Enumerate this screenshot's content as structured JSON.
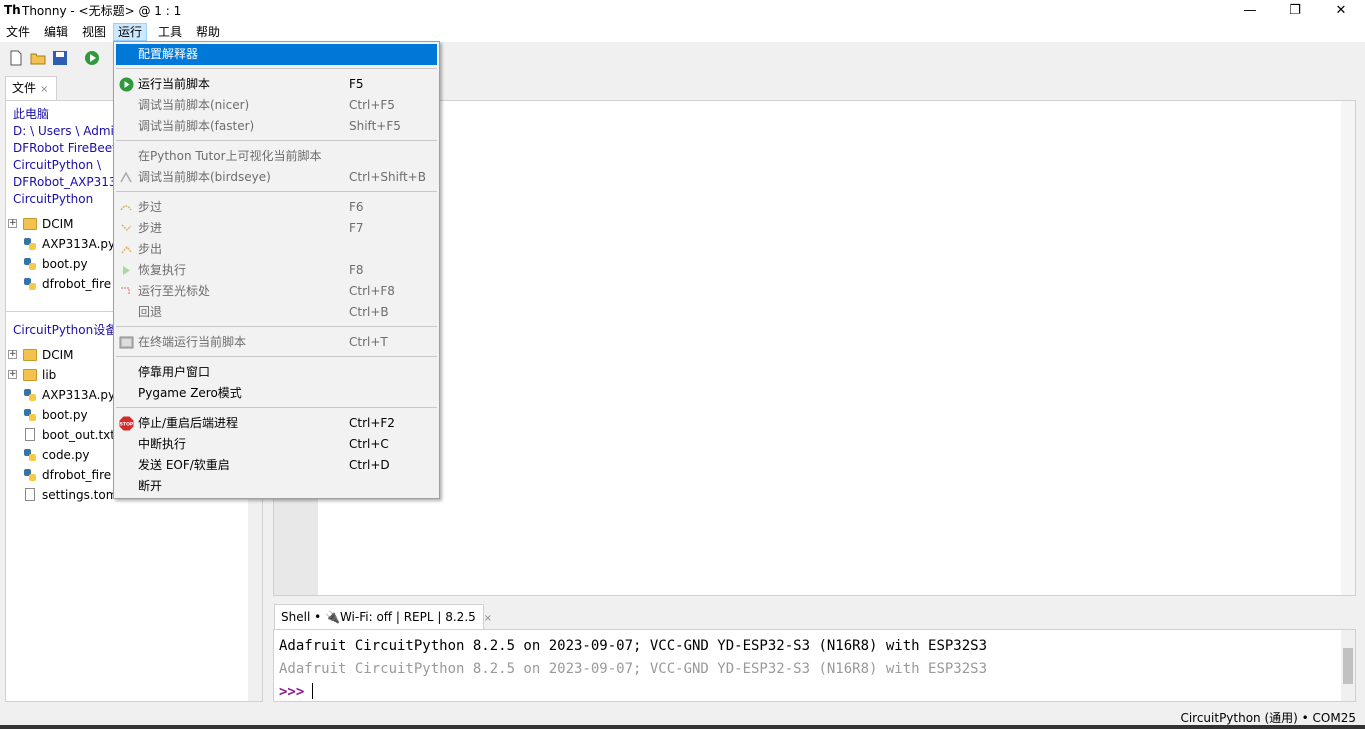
{
  "window": {
    "title": "Thonny  -  <无标题>  @  1 : 1",
    "logo": "Th",
    "buttons": {
      "minimize": "—",
      "maximize": "❐",
      "close": "✕"
    }
  },
  "menubar": [
    "文件",
    "编辑",
    "视图",
    "运行",
    "工具",
    "帮助"
  ],
  "files_panel": {
    "tab_label": "文件",
    "tab_close": "×",
    "local_path": [
      "此电脑",
      "D: \\ Users \\ Admi",
      "DFRobot FireBeet",
      "CircuitPython \\",
      "DFRobot_AXP313",
      "CircuitPython"
    ],
    "local_items": [
      {
        "name": "DCIM",
        "kind": "folder",
        "expandable": true
      },
      {
        "name": "AXP313A.py",
        "kind": "py",
        "expandable": false
      },
      {
        "name": "boot.py",
        "kind": "py",
        "expandable": false
      },
      {
        "name": "dfrobot_fire",
        "kind": "py",
        "expandable": false
      }
    ],
    "device_header": "CircuitPython设备",
    "device_items": [
      {
        "name": "DCIM",
        "kind": "folder",
        "expandable": true
      },
      {
        "name": "lib",
        "kind": "folder",
        "expandable": true
      },
      {
        "name": "AXP313A.py",
        "kind": "py",
        "expandable": false
      },
      {
        "name": "boot.py",
        "kind": "py",
        "expandable": false
      },
      {
        "name": "boot_out.txt",
        "kind": "txt",
        "expandable": false
      },
      {
        "name": "code.py",
        "kind": "py",
        "expandable": false
      },
      {
        "name": "dfrobot_fire",
        "kind": "py",
        "expandable": false
      },
      {
        "name": "settings.toml",
        "kind": "txt",
        "expandable": false
      }
    ]
  },
  "shell": {
    "tab_label": "Shell •",
    "tab_backend": "Wi-Fi: off | REPL | 8.2.5",
    "tab_close": "×",
    "lines": [
      "  Adafruit CircuitPython 8.2.5 on 2023-09-07; VCC-GND YD-ESP32-S3 (N16R8) with ESP32S3",
      "Adafruit CircuitPython 8.2.5 on 2023-09-07; VCC-GND YD-ESP32-S3 (N16R8) with ESP32S3"
    ],
    "prompt": ">>>"
  },
  "statusbar": {
    "text": "CircuitPython (通用)  •  COM25"
  },
  "run_menu": {
    "items": [
      {
        "label": "配置解释器",
        "shortcut": "",
        "disabled": false,
        "highlight": true,
        "icon": ""
      },
      {
        "sep": true
      },
      {
        "label": "运行当前脚本",
        "shortcut": "F5",
        "disabled": false,
        "icon": "run-icon"
      },
      {
        "label": "调试当前脚本(nicer)",
        "shortcut": "Ctrl+F5",
        "disabled": true,
        "icon": ""
      },
      {
        "label": "调试当前脚本(faster)",
        "shortcut": "Shift+F5",
        "disabled": true,
        "icon": ""
      },
      {
        "sep": true
      },
      {
        "label": "在Python Tutor上可视化当前脚本",
        "shortcut": "",
        "disabled": true,
        "icon": ""
      },
      {
        "label": "调试当前脚本(birdseye)",
        "shortcut": "Ctrl+Shift+B",
        "disabled": true,
        "icon": "birdseye-icon"
      },
      {
        "sep": true
      },
      {
        "label": "步过",
        "shortcut": "F6",
        "disabled": true,
        "icon": "step-over-icon"
      },
      {
        "label": "步进",
        "shortcut": "F7",
        "disabled": true,
        "icon": "step-into-icon"
      },
      {
        "label": "步出",
        "shortcut": "",
        "disabled": true,
        "icon": "step-out-icon"
      },
      {
        "label": "恢复执行",
        "shortcut": "F8",
        "disabled": true,
        "icon": "resume-icon"
      },
      {
        "label": "运行至光标处",
        "shortcut": "Ctrl+F8",
        "disabled": true,
        "icon": "run-to-cursor-icon"
      },
      {
        "label": "回退",
        "shortcut": "Ctrl+B",
        "disabled": true,
        "icon": ""
      },
      {
        "sep": true
      },
      {
        "label": "在终端运行当前脚本",
        "shortcut": "Ctrl+T",
        "disabled": true,
        "icon": "terminal-icon"
      },
      {
        "sep": true
      },
      {
        "label": "停靠用户窗口",
        "shortcut": "",
        "disabled": false,
        "icon": ""
      },
      {
        "label": "Pygame Zero模式",
        "shortcut": "",
        "disabled": false,
        "icon": ""
      },
      {
        "sep": true
      },
      {
        "label": "停止/重启后端进程",
        "shortcut": "Ctrl+F2",
        "disabled": false,
        "icon": "stop-icon"
      },
      {
        "label": "中断执行",
        "shortcut": "Ctrl+C",
        "disabled": false,
        "icon": ""
      },
      {
        "label": "发送 EOF/软重启",
        "shortcut": "Ctrl+D",
        "disabled": false,
        "icon": ""
      },
      {
        "label": "断开",
        "shortcut": "",
        "disabled": false,
        "icon": ""
      }
    ]
  }
}
